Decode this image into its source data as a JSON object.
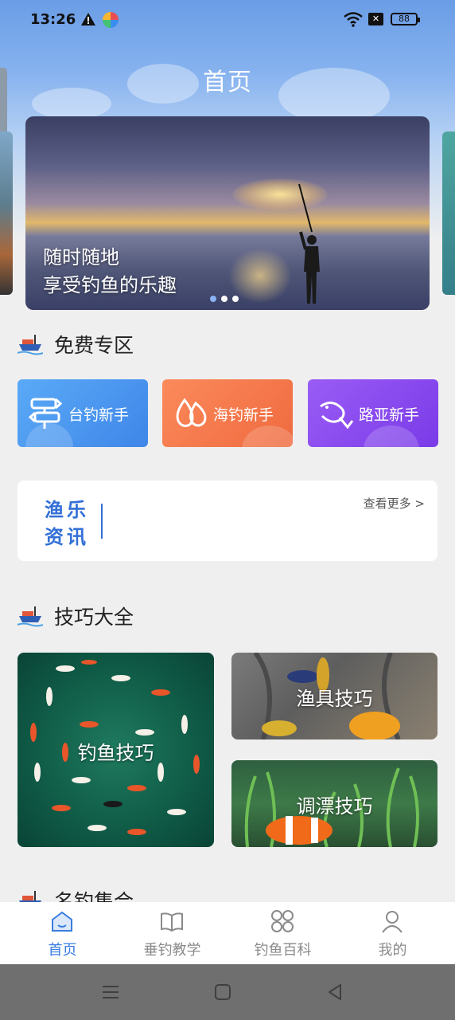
{
  "status_bar": {
    "time": "13:26",
    "battery": "88"
  },
  "header": {
    "title": "首页"
  },
  "banner": {
    "line1": "随时随地",
    "line2": "享受钓鱼的乐趣",
    "dots": 3,
    "active_dot": 1
  },
  "free_section": {
    "title": "免费专区",
    "cards": [
      {
        "label": "台钓新手",
        "icon": "signpost-icon",
        "color": "#4a95f0"
      },
      {
        "label": "海钓新手",
        "icon": "water-drops-icon",
        "color": "#f77a4f"
      },
      {
        "label": "路亚新手",
        "icon": "fish-icon",
        "color": "#8a4ff0"
      }
    ]
  },
  "news": {
    "logo_line1": "渔乐",
    "logo_line2": "资讯",
    "more": "查看更多 >"
  },
  "tips_section": {
    "title": "技巧大全",
    "cards": [
      {
        "label": "钓鱼技巧"
      },
      {
        "label": "渔具技巧"
      },
      {
        "label": "调漂技巧"
      }
    ]
  },
  "next_section": {
    "title": "名钓集合"
  },
  "bottom_nav": {
    "items": [
      {
        "label": "首页",
        "icon": "home-icon",
        "active": true
      },
      {
        "label": "垂钓教学",
        "icon": "book-icon",
        "active": false
      },
      {
        "label": "钓鱼百科",
        "icon": "grid-icon",
        "active": false
      },
      {
        "label": "我的",
        "icon": "user-icon",
        "active": false
      }
    ]
  },
  "colors": {
    "accent": "#3a7de0",
    "background": "#efefef"
  }
}
